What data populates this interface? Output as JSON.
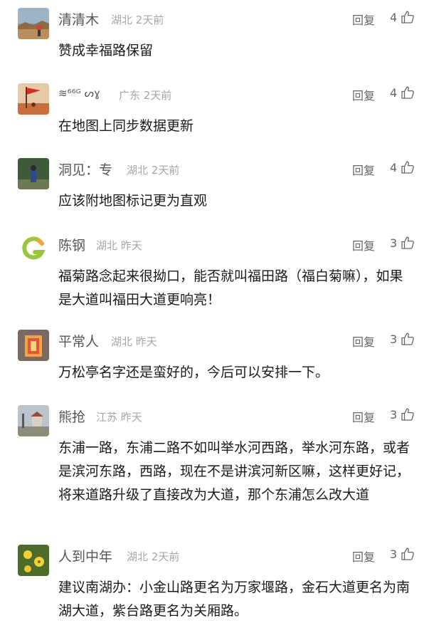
{
  "comments": [
    {
      "name": "清清木",
      "region": "湖北",
      "time": "2天前",
      "reply": "回复",
      "likes": "4",
      "text": "赞成幸福路保留"
    },
    {
      "name": "≋⁶⁶ᴳ ᔕɣ",
      "region": "广东",
      "time": "2天前",
      "reply": "回复",
      "likes": "4",
      "text": "在地图上同步数据更新"
    },
    {
      "name": "洞见：专",
      "region": "湖北",
      "time": "2天前",
      "reply": "回复",
      "likes": "4",
      "text": "应该附地图标记更为直观"
    },
    {
      "name": "陈钢",
      "region": "湖北",
      "time": "昨天",
      "reply": "回复",
      "likes": "3",
      "text": "福菊路念起来很拗口，能否就叫福田路（福白菊嘛），如果是大道叫福田大道更响亮！"
    },
    {
      "name": "平常人",
      "region": "湖北",
      "time": "昨天",
      "reply": "回复",
      "likes": "3",
      "text": "万松亭名字还是蛮好的，今后可以安排一下。"
    },
    {
      "name": "熊抢",
      "region": "江苏",
      "time": "昨天",
      "reply": "回复",
      "likes": "3",
      "text": "东浦一路，东浦二路不如叫举水河西路，举水河东路，或者是滨河东路，西路，现在不是讲滨河新区嘛，这样更好记，将来道路升级了直接改为大道，那个东浦怎么改大道"
    },
    {
      "name": "人到中年",
      "region": "湖北",
      "time": "2天前",
      "reply": "回复",
      "likes": "3",
      "text": "建议南湖办：小金山路更名为万家堰路，金石大道更名为南湖大道，紫台路更名为关厢路。"
    }
  ],
  "colors": {
    "name": "#555555",
    "meta": "#a6a6a6",
    "text": "#1a1a1a",
    "logo_green": "#9bc53d",
    "logo_orange": "#f2a33a"
  }
}
